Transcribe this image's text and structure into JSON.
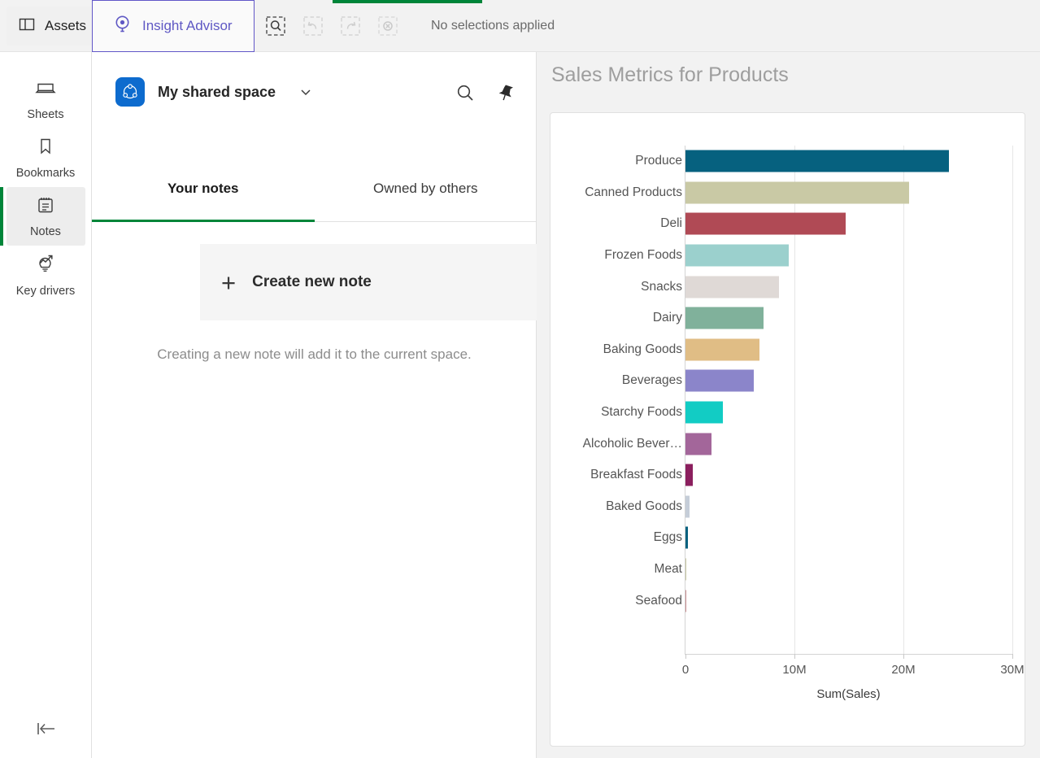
{
  "topbar": {
    "assets_label": "Assets",
    "assets_icon": "panel-icon",
    "insight_advisor_label": "Insight Advisor",
    "insight_advisor_icon": "insight-advisor-icon",
    "tools": [
      {
        "name": "selection-search-icon",
        "label": "Selection search",
        "disabled": false
      },
      {
        "name": "undo-icon",
        "label": "Undo",
        "disabled": true
      },
      {
        "name": "redo-icon",
        "label": "Redo",
        "disabled": true
      },
      {
        "name": "clear-selections-icon",
        "label": "Clear all selections",
        "disabled": true
      }
    ],
    "selection_status": "No selections applied",
    "accent_color": "#008539",
    "tab_border_color": "#6157c8"
  },
  "rail": {
    "items": [
      {
        "label": "Sheets",
        "icon": "sheets-icon",
        "active": false
      },
      {
        "label": "Bookmarks",
        "icon": "bookmark-icon",
        "active": false
      },
      {
        "label": "Notes",
        "icon": "notes-icon",
        "active": true
      },
      {
        "label": "Key drivers",
        "icon": "key-drivers-icon",
        "active": false
      }
    ],
    "collapse_icon": "collapse-left-icon"
  },
  "notes": {
    "space_name": "My shared space",
    "space_icon": "shared-space-icon",
    "space_chevron_icon": "chevron-down-icon",
    "search_icon": "search-icon",
    "pin_icon": "pin-icon",
    "tabs": [
      {
        "label": "Your notes",
        "active": true
      },
      {
        "label": "Owned by others",
        "active": false
      }
    ],
    "create_note_label": "Create new note",
    "create_note_icon": "plus-icon",
    "empty_message": "Creating a new note will add it to the current space."
  },
  "chart_panel": {
    "title": "Sales Metrics for Products"
  },
  "chart_data": {
    "type": "bar",
    "orientation": "horizontal",
    "title": "Sales Metrics for Products",
    "xlabel": "Sum(Sales)",
    "ylabel": "",
    "xlim": [
      0,
      30000000
    ],
    "xticks": [
      0,
      10000000,
      20000000,
      30000000
    ],
    "xtick_labels": [
      "0",
      "10M",
      "20M",
      "30M"
    ],
    "grid": true,
    "legend": false,
    "categories": [
      "Produce",
      "Canned Products",
      "Deli",
      "Frozen Foods",
      "Snacks",
      "Dairy",
      "Baking Goods",
      "Beverages",
      "Starchy Foods",
      "Alcoholic Bever…",
      "Breakfast Foods",
      "Baked Goods",
      "Eggs",
      "Meat",
      "Seafood"
    ],
    "values": [
      24200000,
      20500000,
      14700000,
      9500000,
      8600000,
      7200000,
      6800000,
      6300000,
      3400000,
      2400000,
      700000,
      370000,
      220000,
      60000,
      40000
    ],
    "colors": [
      "#06617f",
      "#c9c9a5",
      "#b04a55",
      "#9bd0cd",
      "#dfd9d6",
      "#80b19b",
      "#e0bd85",
      "#8b85ca",
      "#12ccc4",
      "#a3669a",
      "#8b1f5e",
      "#c5cdd8",
      "#06617f",
      "#c9c9a5",
      "#c98f92"
    ]
  }
}
